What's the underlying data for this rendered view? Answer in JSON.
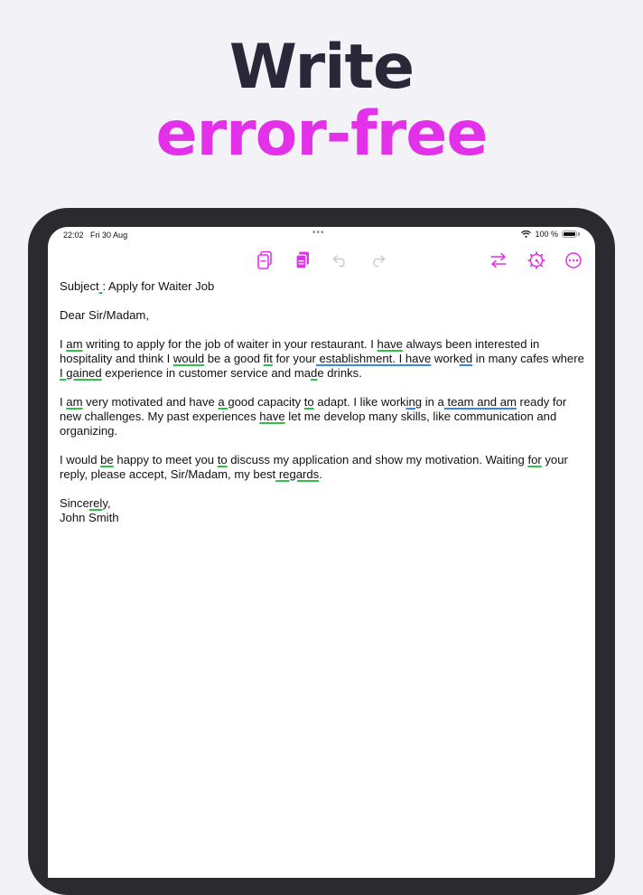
{
  "headline": {
    "line1": "Write",
    "line2": "error-free"
  },
  "colors": {
    "accent": "#e331ea",
    "headline_dark": "#2a2738",
    "grammar_underline": "#2fc24b",
    "style_underline": "#3a86e8"
  },
  "status": {
    "time": "22:02",
    "date": "Fri 30 Aug",
    "dots": "•••",
    "battery": "100 %"
  },
  "toolbar": {
    "icons": [
      "copy-icon",
      "paste-icon",
      "undo-icon",
      "redo-icon",
      "swap-icon",
      "settings-icon",
      "more-icon"
    ]
  },
  "letter": {
    "p1": [
      "Subject",
      " ",
      ":",
      " Apply for Waiter Job"
    ],
    "p2": [
      "Dear Sir/Madam,"
    ],
    "p3": [
      "I ",
      "am",
      " writing to apply for the job of waiter in your restaurant. I ",
      "have",
      " always been interested in hospitality and think I ",
      "would",
      " be a good ",
      "fit",
      " for your",
      " establishment. I have",
      " work",
      "ed",
      " in many cafes where",
      " I gained",
      ""
    ],
    "p3b": [
      " experience in customer service and ma",
      "d",
      "e drinks."
    ],
    "p4": [
      "I ",
      "am",
      " very motivated and have ",
      "a ",
      "good capacity ",
      "to",
      " adapt. I like work",
      "ing",
      " in a",
      " team and am",
      " ready for new challenges. My past experiences ",
      "have",
      " let me develop many skills, like communication and organizing."
    ],
    "p5": [
      "I would ",
      "be",
      " happy to meet you ",
      "to",
      " discuss my application and show my motivation. Waiting ",
      "for",
      " your reply, please accept, Sir/Madam, my best",
      " regards",
      "."
    ],
    "p6": [
      "Since",
      "rel",
      "y,"
    ],
    "p7": [
      "John Smith"
    ]
  }
}
